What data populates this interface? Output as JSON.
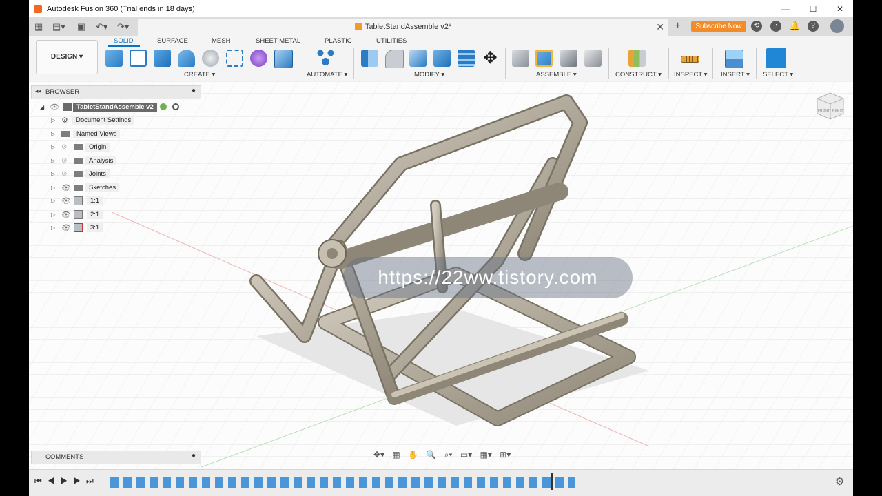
{
  "window": {
    "title": "Autodesk Fusion 360 (Trial ends in 18 days)",
    "controls": {
      "minimize": "—",
      "maximize": "☐",
      "close": "✕"
    }
  },
  "tabbar": {
    "doc_title": "TabletStandAssemble v2*",
    "close_glyph": "✕",
    "new_tab_glyph": "+",
    "subscribe_label": "Subscribe Now"
  },
  "toolbar": {
    "design_label": "DESIGN ▾",
    "workspace_tabs": [
      "SOLID",
      "SURFACE",
      "MESH",
      "SHEET METAL",
      "PLASTIC",
      "UTILITIES"
    ],
    "groups": {
      "create": "CREATE ▾",
      "automate": "AUTOMATE ▾",
      "modify": "MODIFY ▾",
      "assemble": "ASSEMBLE ▾",
      "construct": "CONSTRUCT ▾",
      "inspect": "INSPECT ▾",
      "insert": "INSERT ▾",
      "select": "SELECT ▾"
    }
  },
  "browser": {
    "title": "BROWSER",
    "root": "TabletStandAssemble v2",
    "items": [
      "Document Settings",
      "Named Views",
      "Origin",
      "Analysis",
      "Joints",
      "Sketches",
      "1:1",
      "2:1",
      "3:1"
    ]
  },
  "comments": {
    "title": "COMMENTS"
  },
  "viewcube": {
    "top": "TOP",
    "front": "FRONT",
    "right": "RIGHT"
  },
  "watermark": "https://22ww.tistory.com",
  "colors": {
    "accent": "#0a73c4",
    "subscribe": "#f28c28",
    "model": "#b7b0a1"
  }
}
